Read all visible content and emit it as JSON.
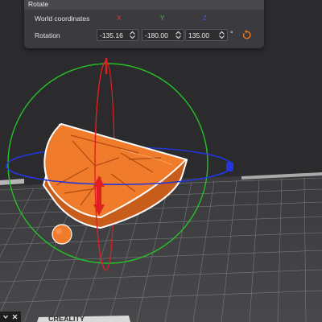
{
  "panel": {
    "title": "Rotate",
    "world_coords_label": "World coordinates",
    "axes": {
      "x": "X",
      "y": "Y",
      "z": "Z"
    },
    "axis_colors": {
      "x": "#e23b3b",
      "y": "#3fbf3f",
      "z": "#3d5ce0"
    },
    "rotation_label": "Rotation",
    "rotation": {
      "x": "-135.16",
      "y": "-180.00",
      "z": "135.00"
    },
    "unit": "°",
    "reset_icon": "undo-icon",
    "reset_color": "#e8791f"
  },
  "scene": {
    "bed_logo": "CREALITY",
    "model_color": "#f07b2a",
    "gizmo_colors": {
      "x_ring": "#e02020",
      "y_ring": "#26c126",
      "z_ring": "#2436e0"
    }
  },
  "bottom_bar": {
    "close_icon": "close-icon"
  }
}
